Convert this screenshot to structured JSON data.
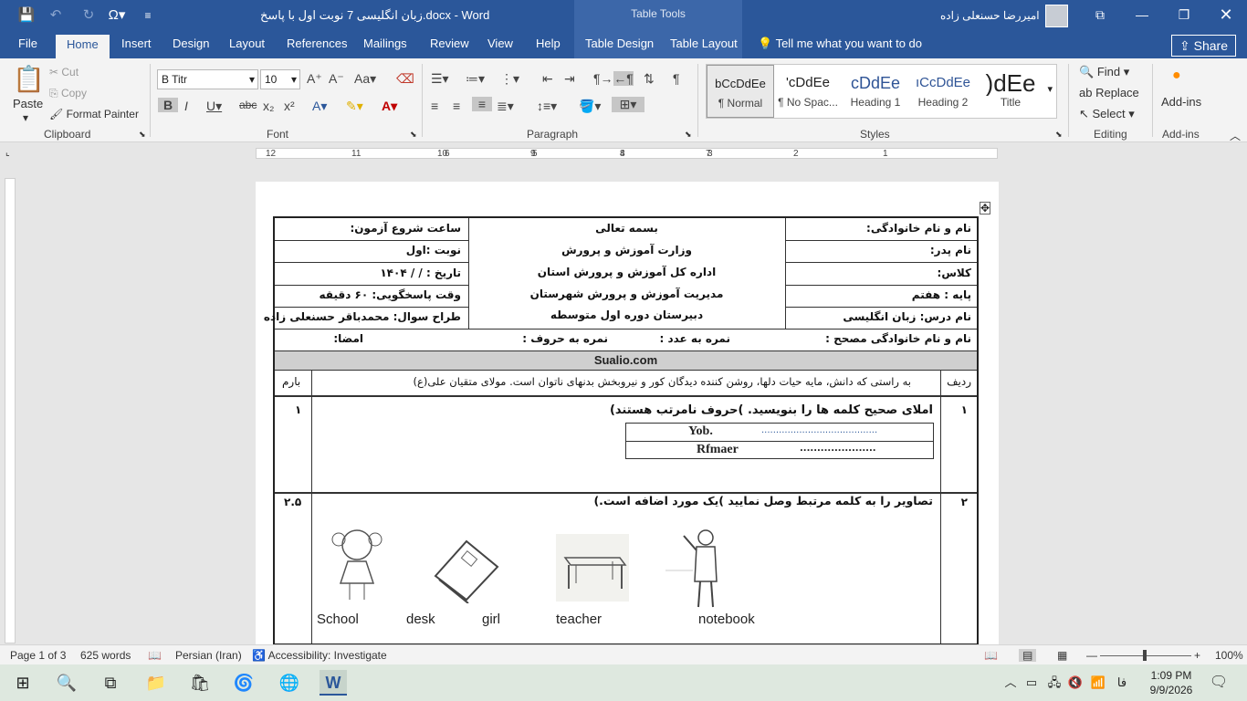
{
  "titlebar": {
    "title": "زبان انگلیسی 7 نوبت اول با پاسخ.docx  -  Word",
    "table_tools": "Table Tools",
    "user_name": "امیررضا حسنعلی زاده"
  },
  "tabs": [
    "File",
    "Home",
    "Insert",
    "Design",
    "Layout",
    "References",
    "Mailings",
    "Review",
    "View",
    "Help",
    "Table Design",
    "Table Layout"
  ],
  "tell_me": "Tell me what you want to do",
  "share_label": "Share",
  "clipboard": {
    "paste": "Paste",
    "cut": "Cut",
    "copy": "Copy",
    "format_painter": "Format Painter",
    "label": "Clipboard"
  },
  "font": {
    "name": "B Titr",
    "size": "10",
    "label": "Font"
  },
  "paragraph": {
    "label": "Paragraph"
  },
  "styles": {
    "items": [
      {
        "preview": "bCcDdEe",
        "label": "¶ Normal"
      },
      {
        "preview": "'cDdEe",
        "label": "¶ No Spac..."
      },
      {
        "preview": "cDdEe",
        "label": "Heading 1"
      },
      {
        "preview": "ıCcDdEe",
        "label": "Heading 2"
      },
      {
        "preview": ")dEe",
        "label": "Title"
      }
    ],
    "label": "Styles"
  },
  "editing": {
    "find": "Find",
    "replace": "Replace",
    "select": "Select",
    "label": "Editing"
  },
  "addins": {
    "button": "Add-ins",
    "label": "Add-ins"
  },
  "ruler_numbers": [
    "12",
    "11",
    "10",
    "9",
    "8",
    "7",
    "6",
    "5",
    "4",
    "3",
    "2",
    "1"
  ],
  "document": {
    "left_col": [
      "ساعت شروع آزمون:",
      "نوبت :اول",
      "تاریخ :   /    /   ۱۴۰۴",
      "وقت پاسخگویی: ۶۰ دقیقه",
      "طراح سوال: محمدباقر حسنعلی زاده"
    ],
    "center_col": [
      "بسمه تعالی",
      "وزارت آموزش و پرورش",
      "اداره کل آموزش و پرورش استان",
      "مدیریت آموزش و پرورش شهرستان",
      "دبیرستان دوره اول متوسطه"
    ],
    "right_col": [
      "نام و نام خانوادگی:",
      "نام پدر:",
      "کلاس:",
      "پایه : هفتم",
      "نام درس: زبان انگلیسی"
    ],
    "grader_row": {
      "name": "نام و نام خانوادگی مصحح :",
      "grade_num": "نمره به عدد :",
      "grade_word": "نمره به حروف :",
      "sign": "امضا:"
    },
    "site": "Sualio.com",
    "header_row": {
      "radif": "ردیف",
      "quote": "به راستی که دانش، مایه حیات دلها، روشن کننده دیدگان کور و نیروبخش بدنهای ناتوان است. مولای متقیان علی(ع)",
      "barem": "بارم"
    },
    "q1": {
      "num": "۱",
      "text": "املای صحیح کلمه ها را بنویسید. )حروف نامرتب هستند)",
      "score": "۱",
      "word1": "Yob.",
      "blank1": "........................................",
      "word2": "Rfmaer",
      "blank2": "......................"
    },
    "q2": {
      "num": "۲",
      "text": "تصاویر را به کلمه مرتبط وصل نمایید )یک مورد اضافه است.)",
      "score": "۲.۵",
      "words": [
        "School",
        "desk",
        "girl",
        "teacher",
        "notebook"
      ]
    }
  },
  "status": {
    "page": "Page 1 of 3",
    "words": "625 words",
    "language": "Persian (Iran)",
    "accessibility": "Accessibility: Investigate",
    "zoom": "100%"
  },
  "taskbar": {
    "time": "1:09 PM",
    "date": "9/9/2026",
    "lang": "فا"
  }
}
